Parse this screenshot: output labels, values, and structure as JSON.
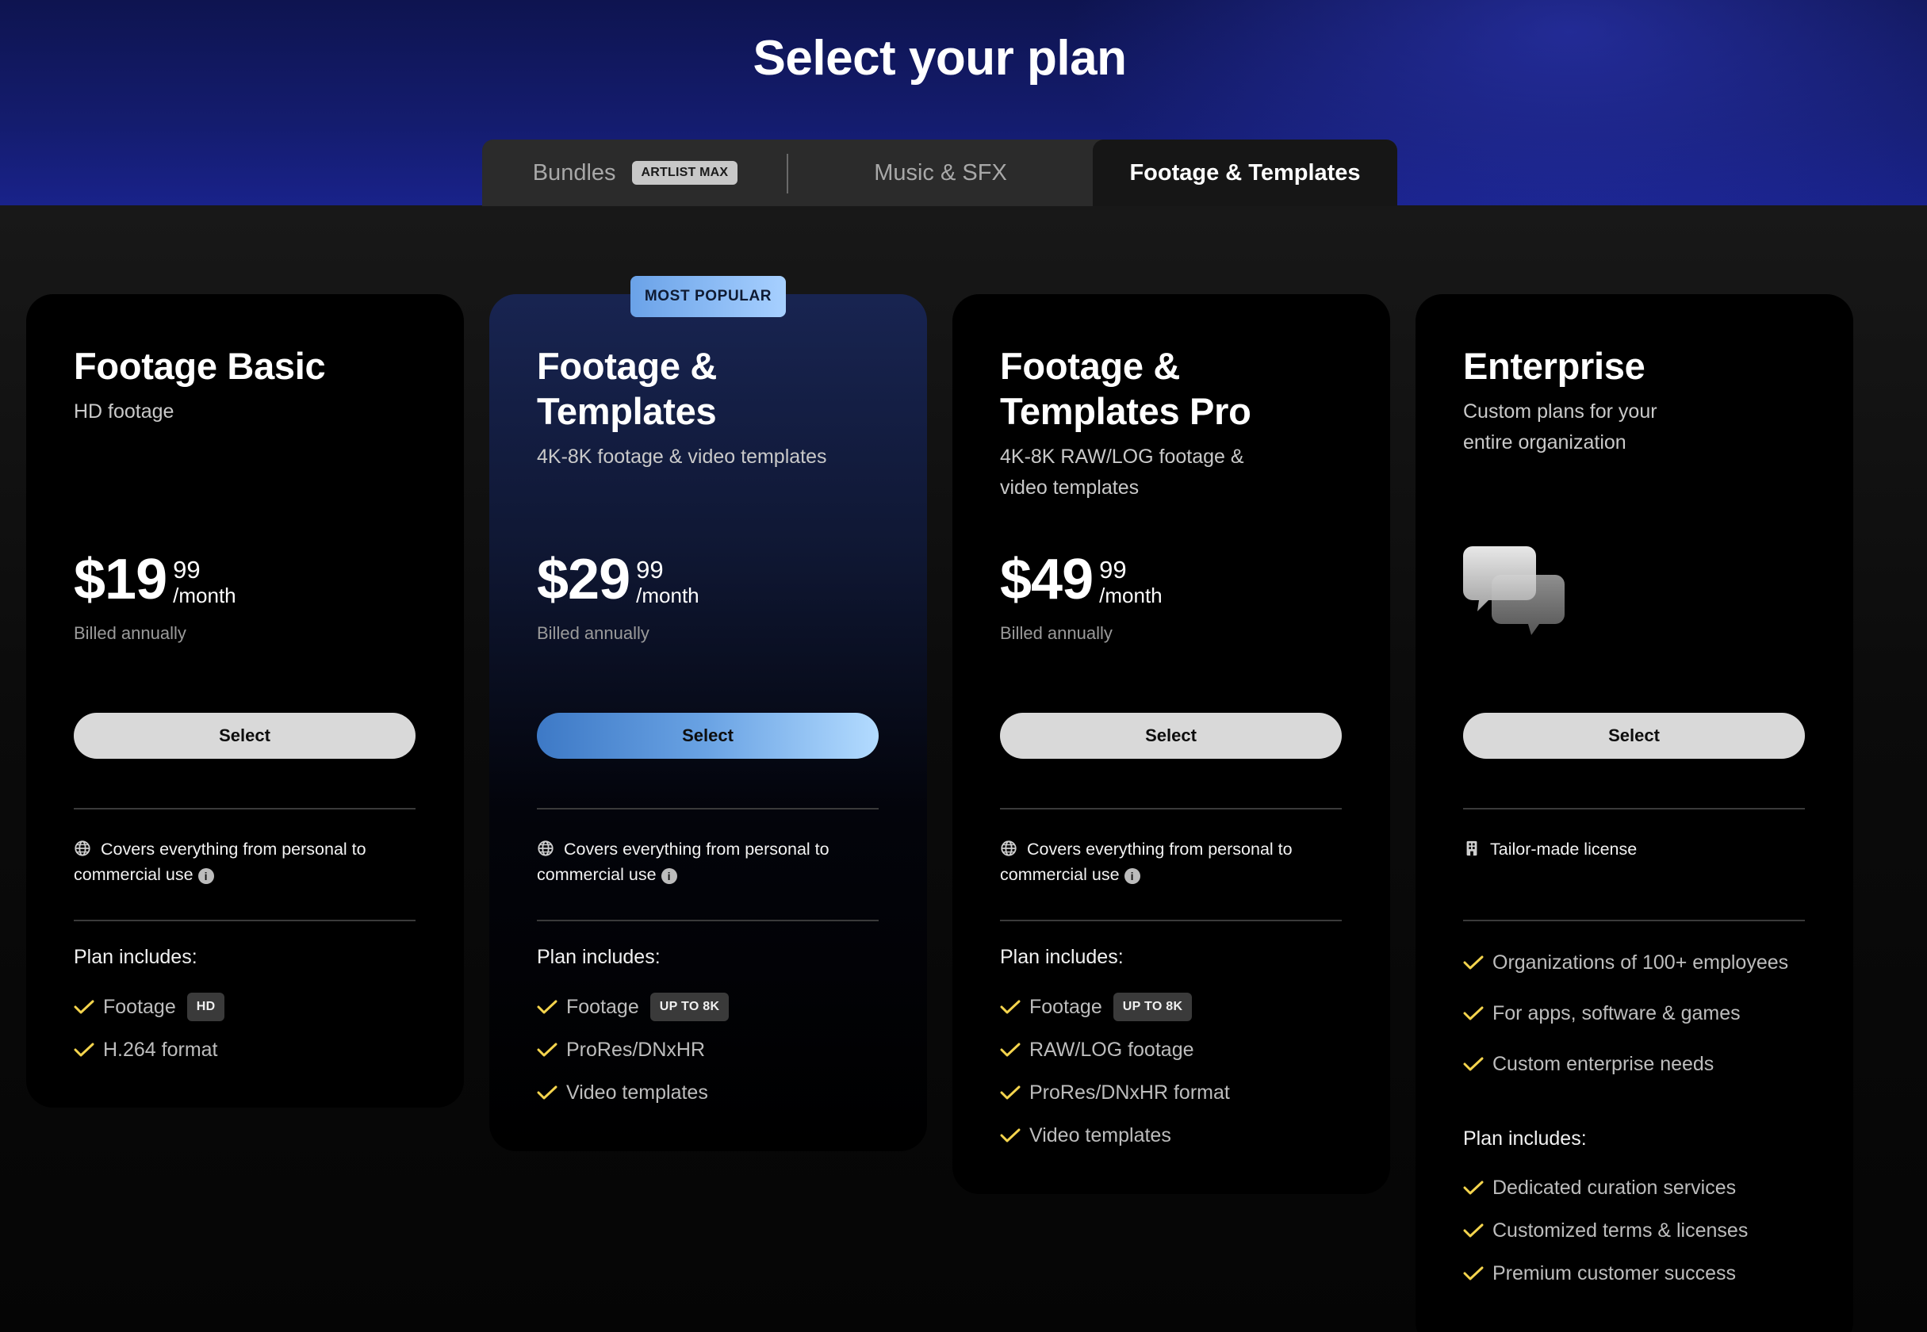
{
  "page": {
    "title": "Select your plan"
  },
  "colors": {
    "accent_yellow": "#f4d44d",
    "popular_blue": "#a7d0ff",
    "hero_blue": "#141c6e"
  },
  "tabs": [
    {
      "label": "Bundles",
      "badge": "ARTLIST MAX",
      "active": false
    },
    {
      "label": "Music & SFX",
      "active": false
    },
    {
      "label": "Footage & Templates",
      "active": true
    }
  ],
  "popular_badge": "MOST POPULAR",
  "plans": [
    {
      "name": "Footage Basic",
      "subtitle": "HD footage",
      "price": "$19",
      "cents": "99",
      "period": "/month",
      "billing": "Billed annually",
      "button": "Select",
      "license": "Covers everything from personal to commercial use",
      "includes_title": "Plan includes:",
      "features": [
        {
          "text": "Footage",
          "badge": "HD"
        },
        {
          "text": "H.264 format"
        }
      ]
    },
    {
      "name": "Footage & Templates",
      "subtitle": "4K-8K footage & video templates",
      "price": "$29",
      "cents": "99",
      "period": "/month",
      "billing": "Billed annually",
      "button": "Select",
      "license": "Covers everything from personal to commercial use",
      "includes_title": "Plan includes:",
      "features": [
        {
          "text": "Footage",
          "badge": "UP TO 8K"
        },
        {
          "text": "ProRes/DNxHR"
        },
        {
          "text": "Video templates"
        }
      ]
    },
    {
      "name": "Footage & Templates Pro",
      "subtitle": "4K-8K RAW/LOG footage & video templates",
      "price": "$49",
      "cents": "99",
      "period": "/month",
      "billing": "Billed annually",
      "button": "Select",
      "license": "Covers everything from personal to commercial use",
      "includes_title": "Plan includes:",
      "features": [
        {
          "text": "Footage",
          "badge": "UP TO 8K"
        },
        {
          "text": "RAW/LOG footage"
        },
        {
          "text": "ProRes/DNxHR format"
        },
        {
          "text": "Video templates"
        }
      ]
    },
    {
      "name": "Enterprise",
      "subtitle": "Custom plans for your entire organization",
      "icon": "chat-bubbles-icon",
      "button": "Select",
      "license": "Tailor-made license",
      "highlights": [
        {
          "text": "Organizations of 100+ employees"
        },
        {
          "text": "For apps, software & games"
        },
        {
          "text": "Custom enterprise needs"
        }
      ],
      "includes_title": "Plan includes:",
      "features": [
        {
          "text": "Dedicated curation services"
        },
        {
          "text": "Customized terms & licenses"
        },
        {
          "text": "Premium customer success"
        }
      ]
    }
  ]
}
